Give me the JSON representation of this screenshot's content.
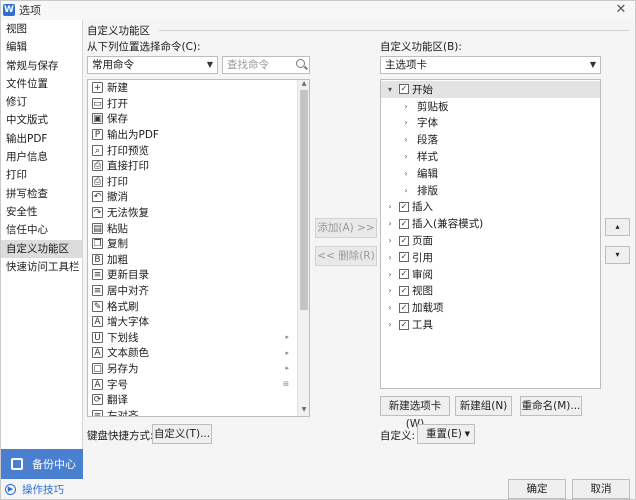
{
  "window": {
    "title": "选项",
    "app_icon": "W",
    "close": "✕"
  },
  "sidebar": {
    "items": [
      "视图",
      "编辑",
      "常规与保存",
      "文件位置",
      "修订",
      "中文版式",
      "输出PDF",
      "用户信息",
      "打印",
      "拼写检查",
      "安全性",
      "信任中心",
      "自定义功能区",
      "快速访问工具栏"
    ],
    "active_index": 12,
    "backup_label": "备份中心",
    "tips_label": "操作技巧"
  },
  "main": {
    "section_title": "自定义功能区",
    "left": {
      "label": "从下列位置选择命令(C):",
      "select_value": "常用命令",
      "search_placeholder": "查找命令",
      "commands": [
        {
          "label": "新建",
          "icon": "+",
          "sub": ""
        },
        {
          "label": "打开",
          "icon": "▭",
          "sub": ""
        },
        {
          "label": "保存",
          "icon": "▣",
          "sub": ""
        },
        {
          "label": "输出为PDF",
          "icon": "P",
          "sub": ""
        },
        {
          "label": "打印预览",
          "icon": "⌕",
          "sub": ""
        },
        {
          "label": "直接打印",
          "icon": "⎙",
          "sub": ""
        },
        {
          "label": "打印",
          "icon": "⎙",
          "sub": ""
        },
        {
          "label": "撤消",
          "icon": "↶",
          "sub": ""
        },
        {
          "label": "无法恢复",
          "icon": "↷",
          "sub": ""
        },
        {
          "label": "粘贴",
          "icon": "▤",
          "sub": ""
        },
        {
          "label": "复制",
          "icon": "❐",
          "sub": ""
        },
        {
          "label": "加粗",
          "icon": "B",
          "sub": ""
        },
        {
          "label": "更新目录",
          "icon": "≡",
          "sub": ""
        },
        {
          "label": "居中对齐",
          "icon": "≡",
          "sub": ""
        },
        {
          "label": "格式刷",
          "icon": "✎",
          "sub": ""
        },
        {
          "label": "增大字体",
          "icon": "A",
          "sub": ""
        },
        {
          "label": "下划线",
          "icon": "U",
          "sub": "▸"
        },
        {
          "label": "文本颜色",
          "icon": "A",
          "sub": "▸"
        },
        {
          "label": "另存为",
          "icon": "▢",
          "sub": "▸"
        },
        {
          "label": "字号",
          "icon": "A",
          "sub": "⊞"
        },
        {
          "label": "翻译",
          "icon": "⟳",
          "sub": ""
        },
        {
          "label": "左对齐",
          "icon": "≡",
          "sub": ""
        }
      ],
      "shortcut_label": "键盘快捷方式:",
      "shortcut_button": "自定义(T)..."
    },
    "middle": {
      "add_button": "添加(A) >>",
      "remove_button": "<< 删除(R)"
    },
    "right": {
      "label": "自定义功能区(B):",
      "select_value": "主选项卡",
      "tree": [
        {
          "label": "开始",
          "level": 0,
          "expander": "▾",
          "checked": true
        },
        {
          "label": "剪贴板",
          "level": 1,
          "expander": "›",
          "checked": null
        },
        {
          "label": "字体",
          "level": 1,
          "expander": "›",
          "checked": null
        },
        {
          "label": "段落",
          "level": 1,
          "expander": "›",
          "checked": null
        },
        {
          "label": "样式",
          "level": 1,
          "expander": "›",
          "checked": null
        },
        {
          "label": "编辑",
          "level": 1,
          "expander": "›",
          "checked": null
        },
        {
          "label": "排版",
          "level": 1,
          "expander": "›",
          "checked": null
        },
        {
          "label": "插入",
          "level": 0,
          "expander": "›",
          "checked": true
        },
        {
          "label": "插入(兼容模式)",
          "level": 0,
          "expander": "›",
          "checked": true
        },
        {
          "label": "页面",
          "level": 0,
          "expander": "›",
          "checked": true
        },
        {
          "label": "引用",
          "level": 0,
          "expander": "›",
          "checked": true
        },
        {
          "label": "审阅",
          "level": 0,
          "expander": "›",
          "checked": true
        },
        {
          "label": "视图",
          "level": 0,
          "expander": "›",
          "checked": true
        },
        {
          "label": "加载项",
          "level": 0,
          "expander": "›",
          "checked": true
        },
        {
          "label": "工具",
          "level": 0,
          "expander": "›",
          "checked": true
        }
      ],
      "new_tab_button": "新建选项卡(W)",
      "new_group_button": "新建组(N)",
      "rename_button": "重命名(M)...",
      "custom_label": "自定义:",
      "reset_button": "重置(E)",
      "move_up": "▴",
      "move_down": "▾"
    },
    "ok_button": "确定",
    "cancel_button": "取消"
  }
}
